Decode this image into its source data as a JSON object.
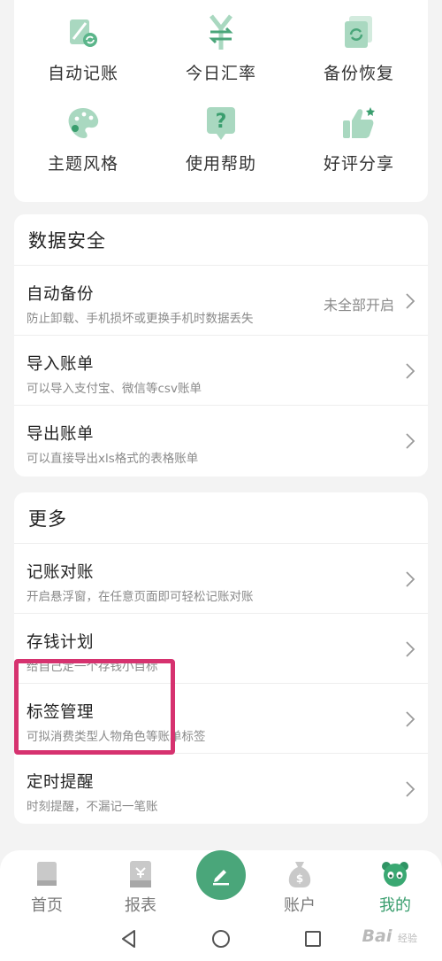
{
  "grid": {
    "items": [
      {
        "label": "自动记账",
        "icon": "auto-bookkeeping-icon"
      },
      {
        "label": "今日汇率",
        "icon": "exchange-rate-icon"
      },
      {
        "label": "备份恢复",
        "icon": "backup-restore-icon"
      },
      {
        "label": "主题风格",
        "icon": "palette-icon"
      },
      {
        "label": "使用帮助",
        "icon": "help-icon"
      },
      {
        "label": "好评分享",
        "icon": "thumbs-up-icon"
      }
    ]
  },
  "security": {
    "title": "数据安全",
    "rows": [
      {
        "title": "自动备份",
        "subtitle": "防止卸载、手机损坏或更换手机时数据丢失",
        "value": "未全部开启"
      },
      {
        "title": "导入账单",
        "subtitle": "可以导入支付宝、微信等csv账单"
      },
      {
        "title": "导出账单",
        "subtitle": "可以直接导出xls格式的表格账单"
      }
    ]
  },
  "more": {
    "title": "更多",
    "rows": [
      {
        "title": "记账对账",
        "subtitle": "开启悬浮窗，在任意页面即可轻松记账对账"
      },
      {
        "title": "存钱计划",
        "subtitle": "给自己定一个存钱小目标"
      },
      {
        "title": "标签管理",
        "subtitle": "可拟消费类型人物角色等账单标签"
      },
      {
        "title": "定时提醒",
        "subtitle": "时刻提醒，不漏记一笔账"
      }
    ]
  },
  "tabbar": {
    "tabs": [
      {
        "label": "首页",
        "icon": "home-icon"
      },
      {
        "label": "报表",
        "icon": "report-icon"
      },
      {
        "label": "账户",
        "icon": "account-bag-icon"
      },
      {
        "label": "我的",
        "icon": "panda-icon"
      }
    ],
    "active": "我的",
    "center_icon": "pencil-icon"
  },
  "watermark": {
    "brand": "Bai",
    "suffix": "经验"
  },
  "colors": {
    "accent": "#4aa67a",
    "icon_light": "#a9d8c0",
    "highlight": "#d6326f"
  }
}
